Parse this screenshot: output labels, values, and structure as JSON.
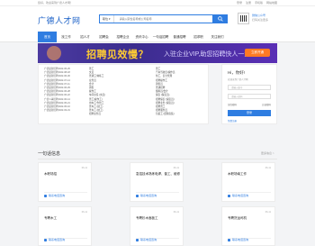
{
  "topbar": {
    "left": "您好，欢迎来到广德人才网！",
    "links": [
      "登录",
      "注册",
      "手机版",
      "网站地图"
    ]
  },
  "header": {
    "logo": "广德人才网",
    "search_category": "职位",
    "search_placeholder": "请输入职位名称或公司名称",
    "qr_line1": "微信公众号",
    "qr_line2": "扫码关注更多"
  },
  "nav": [
    "首页",
    "找工作",
    "招人才",
    "招聘会",
    "招聘企业",
    "资讯中心",
    "一句话招聘",
    "普通招聘",
    "招求职",
    "关注我们"
  ],
  "banner": {
    "headline": "招聘见效慢？",
    "sub": "入驻企业VIP,助您招聘快人一步",
    "button": "立即开通"
  },
  "news_dates": [
    "广德最新招聘2022-05-25",
    "广德最新招聘2022-08-18",
    "广德最新招聘2022-06-30",
    "广德最新招聘2022-07-14",
    "广德最新招聘2022-07-11",
    "广德最新招聘2022-06-29",
    "广德最新招聘2022-06-28",
    "广德最新招聘2022-06-22",
    "广德人事招聘2022-06-14",
    "广德最新招聘2022-05-21",
    "广德最新招聘2022-05-10",
    "广德最新招聘2022-03-31"
  ],
  "jobs_mid": [
    "普工",
    "文员",
    "普通工/熟练工",
    "业务员",
    "会计",
    "销售",
    "操作工",
    "车间主任 (文员)",
    "普工(操作工)",
    "用车工/仓管工",
    "普车工 (技工)",
    "普车工 (技工)",
    "招聘业务员"
  ],
  "jobs_right": [
    "普工",
    "汽车驾驶员/操作员",
    "化工、安全管理",
    "招聘操作工",
    "销售员",
    "普通招聘",
    "储料员/会计",
    "保安 (保安员)",
    "招聘保安 (保安员)",
    "招聘业务 (保安员)",
    "招聘普工",
    "招聘服务员",
    "包装工 (纸箱包装)"
  ],
  "login": {
    "greeting": "Hi，你好!",
    "subtitle": "欢迎来到广德人才网",
    "user_placeholder": "请输入账号",
    "pass_placeholder": "请输入密码",
    "remember": "记住密码",
    "forgot": "忘记密码",
    "button": "登录",
    "footer": "免费注册"
  },
  "section": {
    "title": "一句话信息",
    "more": "更多信息 >"
  },
  "cards": [
    {
      "title": "木职场招",
      "date": "06-11",
      "phone": "联系电话咨询"
    },
    {
      "title": "急招技术熟练电焊、普工、维修",
      "date": "06-11",
      "phone": "联系电话咨询"
    },
    {
      "title": "木职场南工作",
      "date": "06-11",
      "phone": "联系电话咨询"
    },
    {
      "title": "专聘木工",
      "date": "06-11",
      "phone": "联系电话咨询"
    },
    {
      "title": "专聘杉木面板工",
      "date": "06-11",
      "phone": "联系电话咨询"
    },
    {
      "title": "专聘货运司机",
      "date": "06-11",
      "phone": "联系电话咨询"
    }
  ]
}
